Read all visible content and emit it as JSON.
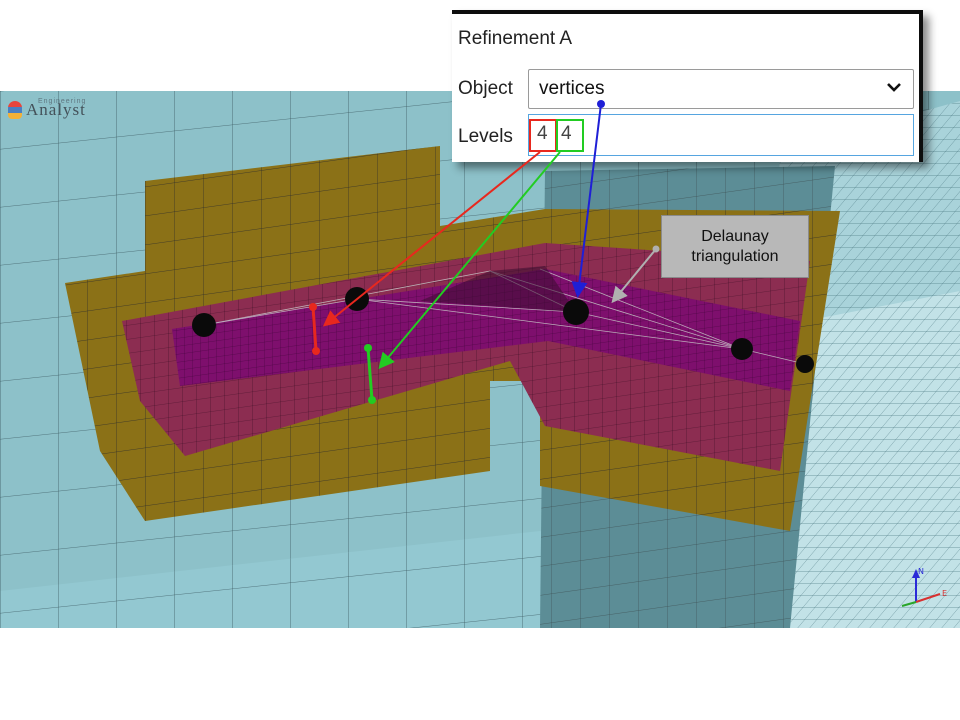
{
  "logo": {
    "text": "Analyst",
    "subtitle": "Engineering"
  },
  "panel": {
    "title": "Refinement A",
    "object_label": "Object",
    "object_value": "vertices",
    "levels_label": "Levels",
    "level_min": "4",
    "level_max": "4"
  },
  "callout": {
    "line1": "Delaunay",
    "line2": "triangulation"
  },
  "axes": {
    "x": "E",
    "y": "N"
  },
  "colors": {
    "background": "#8dc1c9",
    "refinement_outer": "#8b7117",
    "refinement_mid": "#8c2d51",
    "refinement_inner": "#7e0f6d",
    "arrow_red": "#e8281e",
    "arrow_green": "#22cc22",
    "arrow_blue": "#1f1fd6",
    "arrow_gray": "#b0b0b0"
  },
  "icons": [
    "chevron-down-icon",
    "logo-icon",
    "axis-triad-icon"
  ]
}
